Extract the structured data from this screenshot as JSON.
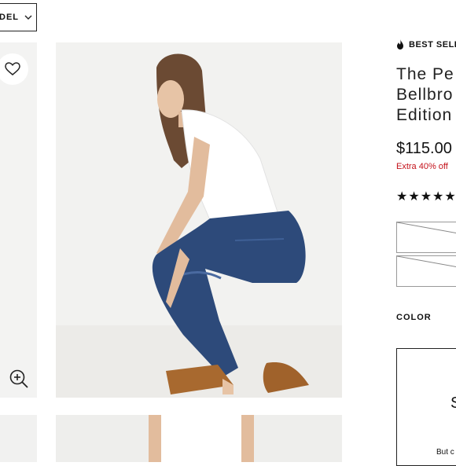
{
  "model_dropdown": {
    "label": "DEL"
  },
  "product": {
    "badge": "BEST SELL",
    "title": "The Pe\nBellbro\nEdition",
    "price": "$115.00",
    "promo": "Extra 40% off",
    "rating_stars": "★★★★★",
    "color_label": "COLOR",
    "card_letter": "S",
    "card_text": "But c"
  },
  "icons": {
    "heart": "heart-icon",
    "zoom": "zoom-in-icon",
    "flame": "flame-icon",
    "chevron": "chevron-down-icon"
  },
  "colors": {
    "promo_red": "#c4121b",
    "denim": "#2d4a7a",
    "photo_bg": "#f2f2f0"
  }
}
